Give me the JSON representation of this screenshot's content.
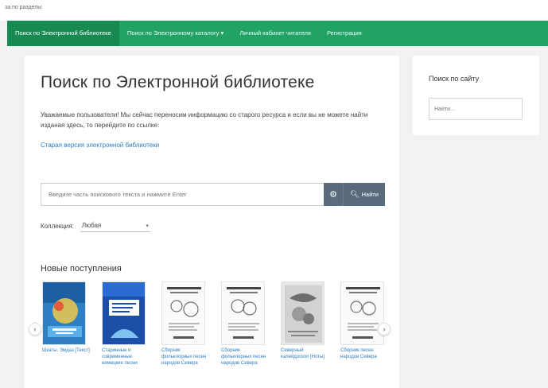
{
  "top_strip": {
    "text": "за по разделы"
  },
  "nav": {
    "items": [
      {
        "label": "Поиск по Электронной библиотеке",
        "active": true
      },
      {
        "label": "Поиск по Электронному каталогу ▾",
        "active": false
      },
      {
        "label": "Личный кабинет читателя",
        "active": false
      },
      {
        "label": "Регистрация",
        "active": false
      }
    ]
  },
  "main": {
    "title": "Поиск по Электронной библиотеке",
    "notice": "Уважаемые пользователи! Мы сейчас переносим информацию со старого ресурса и если вы не можете найти изданая здесь, то перейдите по ссылке:",
    "old_link": "Старая версия электронной библиотеки",
    "search": {
      "placeholder": "Введите часть поискового текста и нажмите Enter",
      "button_label": "Найти"
    },
    "collection": {
      "label": "Коллекция:",
      "value": "Любая"
    },
    "new_arrivals": {
      "heading": "Новые поступления",
      "books": [
        {
          "title": "Шкаты. Эмдаз [Текст]"
        },
        {
          "title": "Старинные и современные немецкие песни"
        },
        {
          "title": "Сборник фольклорных песен народов Севера"
        },
        {
          "title": "Сборник фольклорных песен народов Севера"
        },
        {
          "title": "Северный калейдоскоп [Ноты]"
        },
        {
          "title": "Сборник песен народов Севера"
        }
      ]
    }
  },
  "sidebar": {
    "title": "Поиск по сайту",
    "placeholder": "Найти..."
  },
  "colors": {
    "nav_bg": "#21a366",
    "nav_active": "#178a52",
    "link": "#2a7bbf",
    "button": "#5a6b7b",
    "page_bg": "#f2f2f2"
  }
}
